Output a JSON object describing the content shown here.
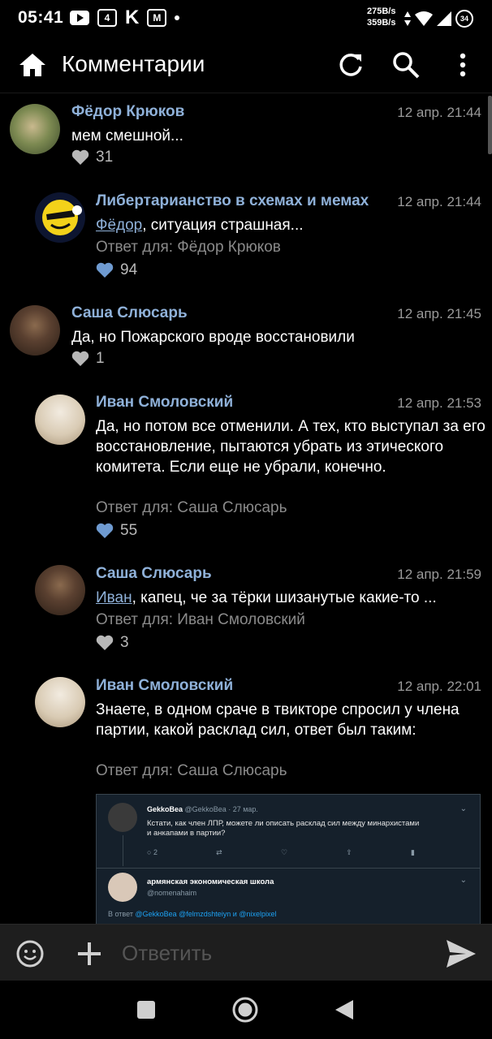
{
  "status_bar": {
    "time": "05:41",
    "net_up": "275B/s",
    "net_down": "359B/s",
    "battery": "34"
  },
  "header": {
    "title": "Комментарии"
  },
  "comments": [
    {
      "name": "Фёдор Крюков",
      "time": "12 апр. 21:44",
      "text": "мем смешной...",
      "likes": "31",
      "liked": false
    },
    {
      "name": "Либертарианство в схемах и мемах",
      "time": "12 апр. 21:44",
      "mention": "Фёдор",
      "text": ", ситуация страшная...",
      "reply_to": "Ответ для: Фёдор Крюков",
      "likes": "94",
      "liked": true
    },
    {
      "name": "Саша Слюсарь",
      "time": "12 апр. 21:45",
      "text": "Да, но Пожарского вроде восстановили",
      "likes": "1",
      "liked": false
    },
    {
      "name": "Иван Смоловский",
      "time": "12 апр. 21:53",
      "text": "Да, но потом все отменили. А тех, кто выступал за его восстановление, пытаются убрать из этического комитета. Если еще не убрали, конечно.",
      "reply_to": "Ответ для: Саша Слюсарь",
      "likes": "55",
      "liked": true
    },
    {
      "name": "Саша Слюсарь",
      "time": "12 апр. 21:59",
      "mention": "Иван",
      "text": ", капец, че за тёрки шизанутые какие-то ...",
      "reply_to": "Ответ для: Иван Смоловский",
      "likes": "3",
      "liked": false
    },
    {
      "name": "Иван Смоловский",
      "time": "12 апр. 22:01",
      "text": "Знаете, в одном сраче в твикторе спросил у члена партии, какой расклад сил, ответ был таким:",
      "reply_to": "Ответ для: Саша Слюсарь"
    }
  ],
  "embed": {
    "tweet1_name": "GekkoBea",
    "tweet1_meta": "@GekkoBea · 27 мар.",
    "tweet1_text": "Кстати, как член ЛПР, можете ли описать расклад сил между минархистами и анкапами в партии?",
    "tweet1_replies": "2",
    "tweet2_name": "армянская экономическая школа",
    "tweet2_handle": "@nomenahaim",
    "reply_prefix": "В ответ",
    "reply_handles": "@GekkoBea @felmzdshteiyn и @nixelpixel"
  },
  "input": {
    "placeholder": "Ответить"
  },
  "colors": {
    "accent": "#8fb1d9",
    "like_active": "#6f9bd1",
    "like_inactive": "#b8b8b8"
  }
}
